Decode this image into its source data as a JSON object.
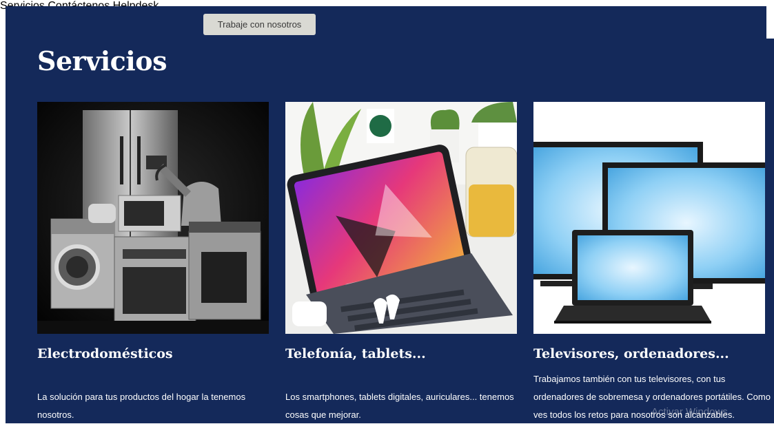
{
  "nav": {
    "items": [
      {
        "label": "Servicios",
        "active": true
      },
      {
        "label": "Contáctenos",
        "active": false
      },
      {
        "label": "Helpdesk",
        "active": false
      }
    ],
    "cta_label": "Trabaje con nosotros"
  },
  "page_title": "Servicios",
  "cards": [
    {
      "title": "Electrodomésticos",
      "description": "La solución para tus productos del hogar la tenemos nosotros.",
      "image": "appliances-photo"
    },
    {
      "title": "Telefonía, tablets...",
      "description": "Los smartphones, tablets digitales, auriculares... tenemos cosas que mejorar.",
      "image": "tablet-keyboard-photo"
    },
    {
      "title": "Televisores, ordenadores...",
      "description": "Trabajamos también con tus televisores, con tus ordenadores de sobremesa y ordenadores portátiles. Como ves todos los retos para nosotros son alcanzables.",
      "image": "screens-laptop-photo"
    }
  ],
  "watermark": "Activar Windows",
  "colors": {
    "background": "#14295a",
    "text": "#ffffff",
    "cta_background": "#d9d9d3",
    "cta_text": "#3a3a3a"
  }
}
